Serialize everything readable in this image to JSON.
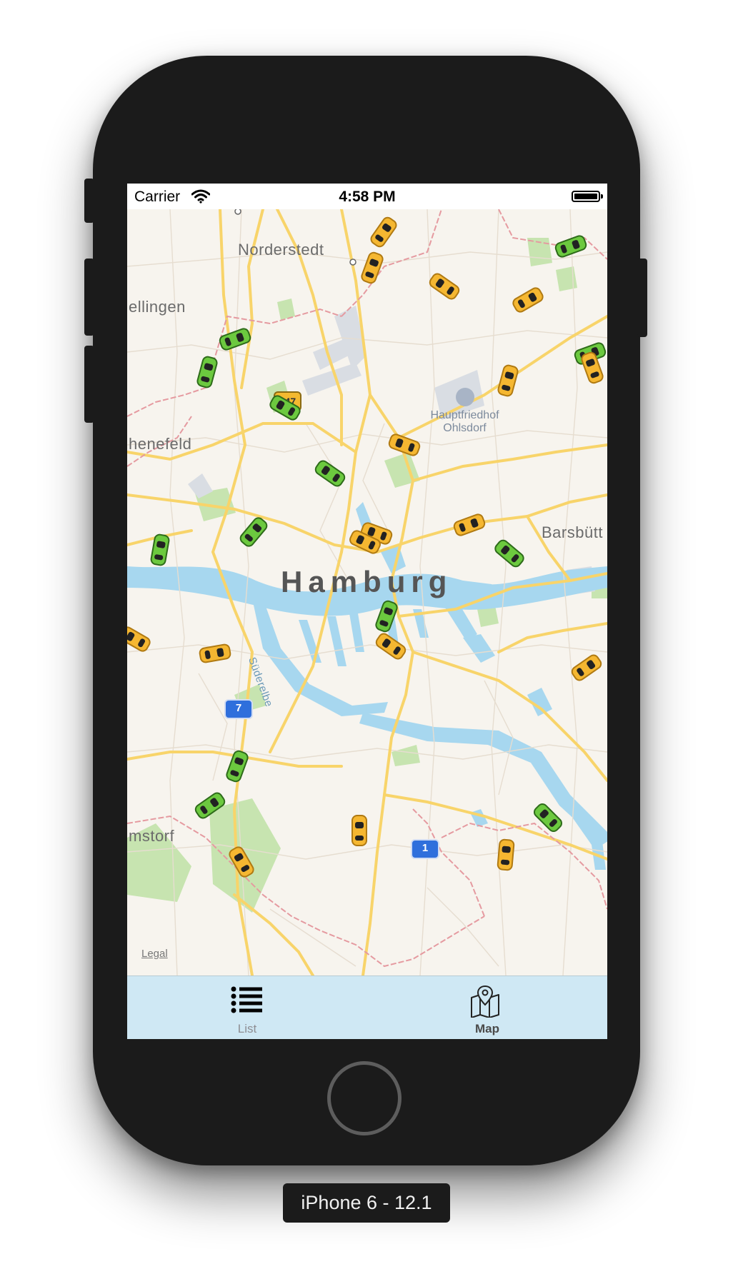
{
  "status_bar": {
    "carrier": "Carrier",
    "time": "4:58 PM",
    "wifi_icon": "wifi-icon",
    "battery_icon": "battery-icon"
  },
  "map": {
    "places": {
      "norderstedt": "Norderstedt",
      "ellingen": "ellingen",
      "henefeld": "henefeld",
      "barsbuett": "Barsbütt",
      "hamburg": "Hamburg",
      "msdorf": "mstorf",
      "suederelbe": "Süderelbe",
      "hauptfriedhof": "Hauptfriedhof Ohlsdorf"
    },
    "road_shields": {
      "b447": "447",
      "a7": "7",
      "a1": "1"
    },
    "legal": "Legal",
    "taxis": {
      "yellow_count": "many",
      "green_count": "many"
    },
    "colors": {
      "land": "#f7f4ee",
      "water": "#a7d7ef",
      "road_major": "#f8d46a",
      "park": "#c7e4b0",
      "border": "#e59aa0",
      "taxi_yellow": "#f5b731",
      "taxi_green": "#6cc93f"
    }
  },
  "tab_bar": {
    "tabs": [
      {
        "label": "List",
        "icon": "list-icon",
        "selected": false
      },
      {
        "label": "Map",
        "icon": "map-pin-icon",
        "selected": true
      }
    ],
    "background": "#cfe8f4"
  },
  "device": {
    "label": "iPhone 6 - 12.1"
  }
}
